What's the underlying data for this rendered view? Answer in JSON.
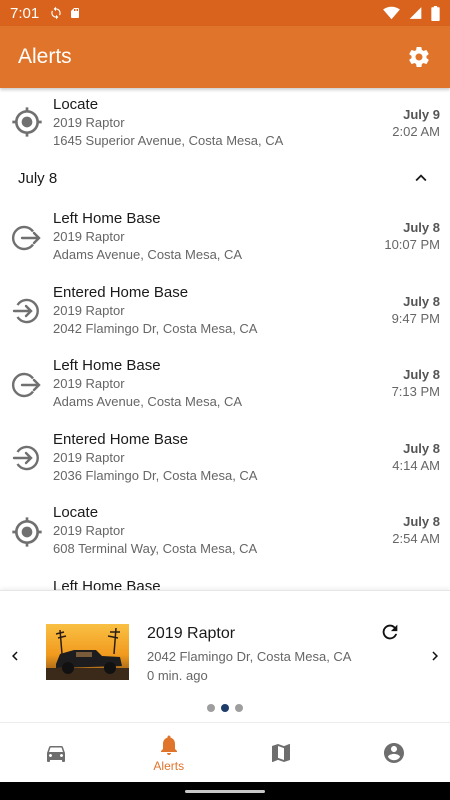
{
  "status_bar": {
    "time": "7:01"
  },
  "app_bar": {
    "title": "Alerts"
  },
  "top_alert": {
    "title": "Locate",
    "vehicle": "2019 Raptor",
    "address": "1645 Superior Avenue, Costa Mesa, CA",
    "date": "July 9",
    "time": "2:02 AM",
    "icon": "locate-icon"
  },
  "group": {
    "label": "July 8"
  },
  "alerts": [
    {
      "title": "Left Home Base",
      "vehicle": "2019 Raptor",
      "address": "Adams Avenue, Costa Mesa, CA",
      "date": "July 8",
      "time": "10:07 PM",
      "icon": "exit-icon"
    },
    {
      "title": "Entered Home Base",
      "vehicle": "2019 Raptor",
      "address": "2042 Flamingo Dr, Costa Mesa, CA",
      "date": "July 8",
      "time": "9:47 PM",
      "icon": "enter-icon"
    },
    {
      "title": "Left Home Base",
      "vehicle": "2019 Raptor",
      "address": "Adams Avenue, Costa Mesa, CA",
      "date": "July 8",
      "time": "7:13 PM",
      "icon": "exit-icon"
    },
    {
      "title": "Entered Home Base",
      "vehicle": "2019 Raptor",
      "address": "2036 Flamingo Dr, Costa Mesa, CA",
      "date": "July 8",
      "time": "4:14 AM",
      "icon": "enter-icon"
    },
    {
      "title": "Locate",
      "vehicle": "2019 Raptor",
      "address": "608 Terminal Way, Costa Mesa, CA",
      "date": "July 8",
      "time": "2:54 AM",
      "icon": "locate-icon"
    },
    {
      "title": "Left Home Base",
      "vehicle": "",
      "address": "",
      "date": "",
      "time": "",
      "icon": "exit-icon"
    }
  ],
  "vehicle_card": {
    "name": "2019 Raptor",
    "address": "2042 Flamingo Dr, Costa Mesa, CA",
    "updated": "0 min. ago",
    "page_count": 3,
    "active_page": 2
  },
  "bottom_nav": {
    "items": [
      {
        "label": "",
        "icon": "car-icon"
      },
      {
        "label": "Alerts",
        "icon": "bell-icon"
      },
      {
        "label": "",
        "icon": "map-icon"
      },
      {
        "label": "",
        "icon": "account-icon"
      }
    ]
  },
  "colors": {
    "accent": "#e0742a",
    "status_bar": "#d9631c",
    "icon_gray": "#707070",
    "dot_active": "#1e3d6b"
  }
}
